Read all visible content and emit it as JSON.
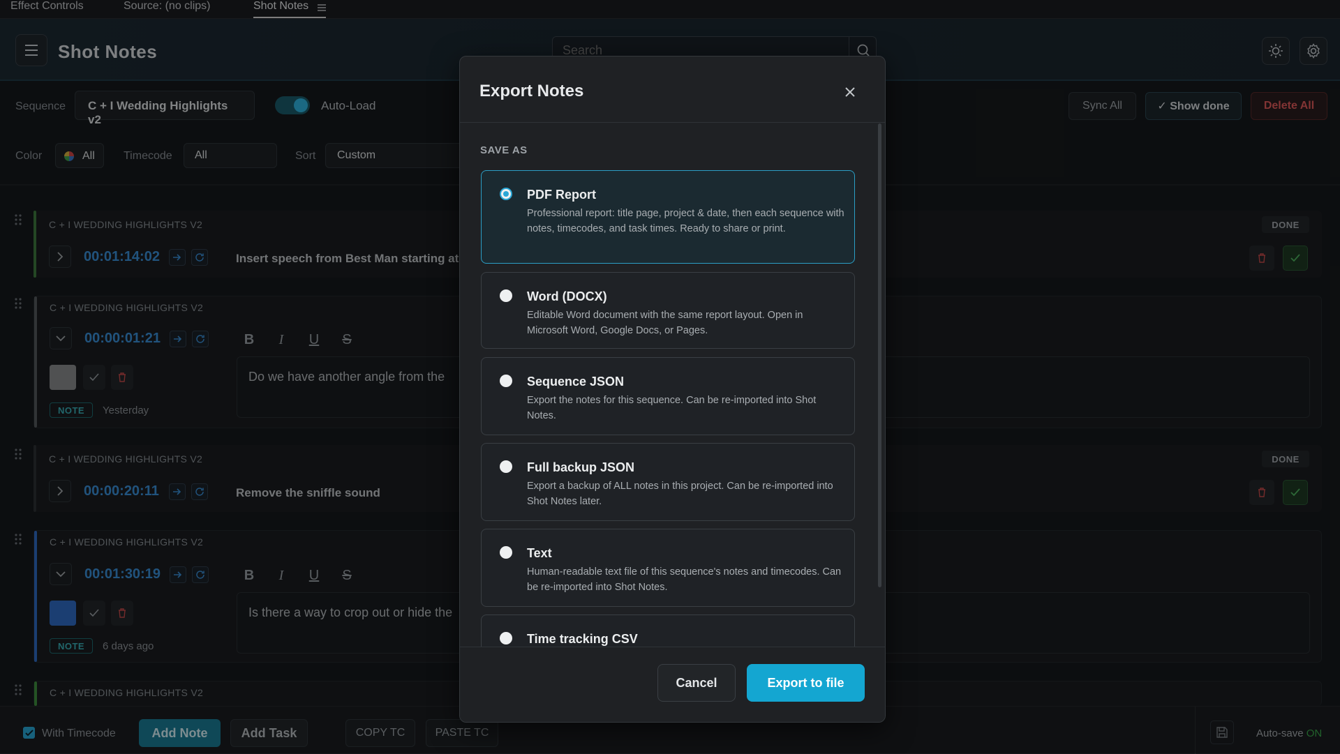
{
  "panel_tabs": [
    {
      "label": "Effect Controls"
    },
    {
      "label": "Source: (no clips)"
    },
    {
      "label": "Shot Notes"
    }
  ],
  "header": {
    "title": "Shot Notes",
    "search_placeholder": "Search"
  },
  "toolbar": {
    "sequence_label": "Sequence",
    "sequence_value": "C + I Wedding Highlights v2",
    "autoload_label": "Auto-Load",
    "autoload_on": true,
    "sync_all": "Sync All",
    "show_done": "✓ Show done",
    "delete_all": "Delete All"
  },
  "filters": {
    "color_label": "Color",
    "color_value": "All",
    "timecode_label": "Timecode",
    "timecode_value": "All",
    "sort_label": "Sort",
    "sort_value": "Custom"
  },
  "notes": [
    {
      "sequence": "C + I WEDDING HIGHLIGHTS V2",
      "timecode": "00:01:14:02",
      "text": "Insert speech from Best Man starting at:",
      "badge": "DONE",
      "bar_color": "#3e7b3e"
    },
    {
      "sequence": "C + I WEDDING HIGHLIGHTS V2",
      "timecode": "00:00:01:21",
      "text": "Do we have another angle from the",
      "tag": "NOTE",
      "when": "Yesterday",
      "swatch": "#8a8c8e",
      "bar_color": "#555a5e"
    },
    {
      "sequence": "C + I WEDDING HIGHLIGHTS V2",
      "timecode": "00:00:20:11",
      "text": "Remove the sniffle sound",
      "badge": "DONE",
      "bar_color": "#2d3135"
    },
    {
      "sequence": "C + I WEDDING HIGHLIGHTS V2",
      "timecode": "00:01:30:19",
      "text": "Is there a way to crop out or hide the",
      "tag": "NOTE",
      "when": "6 days ago",
      "swatch": "#2f6cc4",
      "bar_color": "#2f6cc4"
    },
    {
      "sequence": "C + I WEDDING HIGHLIGHTS V2",
      "bar_color": "#3e8f3e"
    }
  ],
  "format_buttons": [
    "B",
    "I",
    "U",
    "S"
  ],
  "footer": {
    "with_timecode": "With Timecode",
    "add_note": "Add Note",
    "add_task": "Add Task",
    "copy_tc": "COPY TC",
    "paste_tc": "PASTE TC",
    "autosave_label": "Auto-save",
    "autosave_state": "ON"
  },
  "modal": {
    "title": "Export Notes",
    "section": "SAVE AS",
    "options": [
      {
        "title": "PDF Report",
        "desc": "Professional report: title page, project & date, then each sequence with notes, timecodes, and task times. Ready to share or print.",
        "selected": true
      },
      {
        "title": "Word (DOCX)",
        "desc": "Editable Word document with the same report layout. Open in Microsoft Word, Google Docs, or Pages."
      },
      {
        "title": "Sequence JSON",
        "desc": "Export the notes for this sequence. Can be re-imported into Shot Notes."
      },
      {
        "title": "Full backup JSON",
        "desc": "Export a backup of ALL notes in this project. Can be re-imported into Shot Notes later."
      },
      {
        "title": "Text",
        "desc": "Human-readable text file of this sequence's notes and timecodes. Can be re-imported into Shot Notes."
      },
      {
        "title": "Time tracking CSV",
        "desc": ""
      }
    ],
    "cancel": "Cancel",
    "export": "Export to file"
  },
  "colors": {
    "accent": "#14a6d1",
    "timecode": "#3a8fd8",
    "danger": "#e05050",
    "success": "#3e9a4e"
  }
}
